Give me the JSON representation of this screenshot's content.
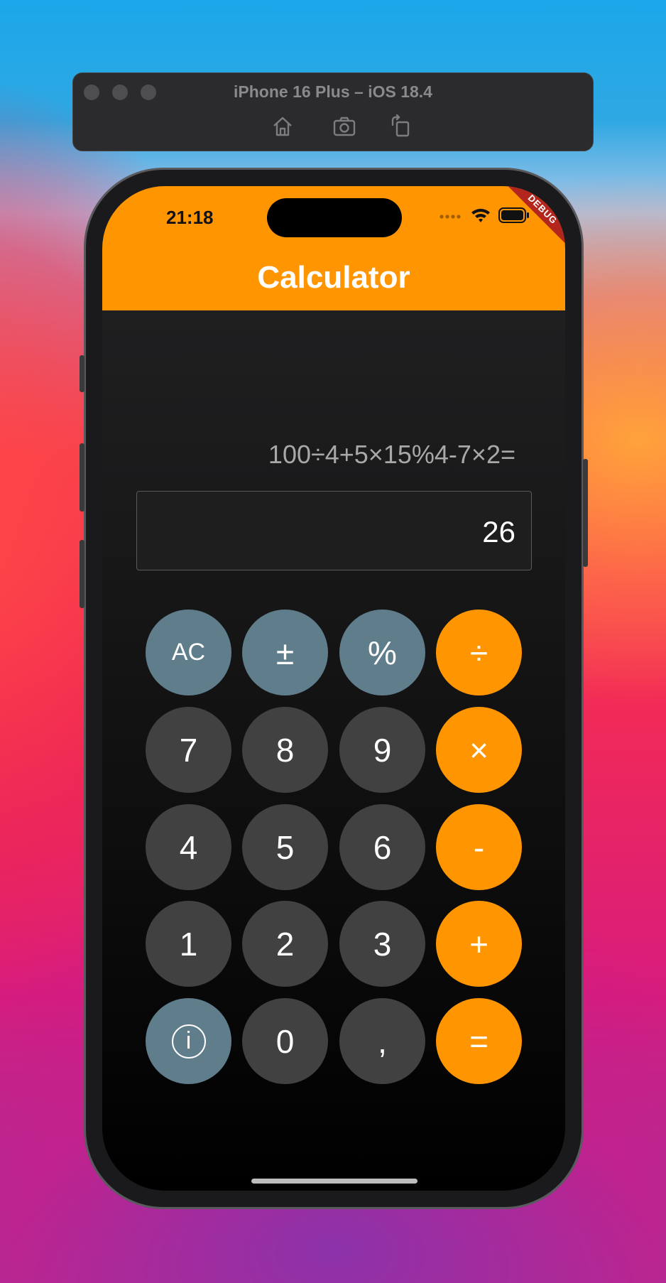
{
  "simulator": {
    "title": "iPhone 16 Plus – iOS 18.4",
    "toolbar": [
      "home-icon",
      "screenshot-icon",
      "rotate-icon"
    ]
  },
  "status_bar": {
    "time": "21:18"
  },
  "app_bar": {
    "title": "Calculator",
    "debug_banner": "DEBUG",
    "color": "#ff9500"
  },
  "display": {
    "expression": "100÷4+5×15%4-7×2=",
    "result": "26"
  },
  "keypad": {
    "row1": [
      "AC",
      "±",
      "%",
      "÷"
    ],
    "row2": [
      "7",
      "8",
      "9",
      "×"
    ],
    "row3": [
      "4",
      "5",
      "6",
      "-"
    ],
    "row4": [
      "1",
      "2",
      "3",
      "+"
    ],
    "row5": [
      "ⓘ",
      "0",
      ",",
      "="
    ]
  },
  "colors": {
    "function_key": "#607d8b",
    "number_key": "#414141",
    "operator_key": "#ff9500"
  }
}
